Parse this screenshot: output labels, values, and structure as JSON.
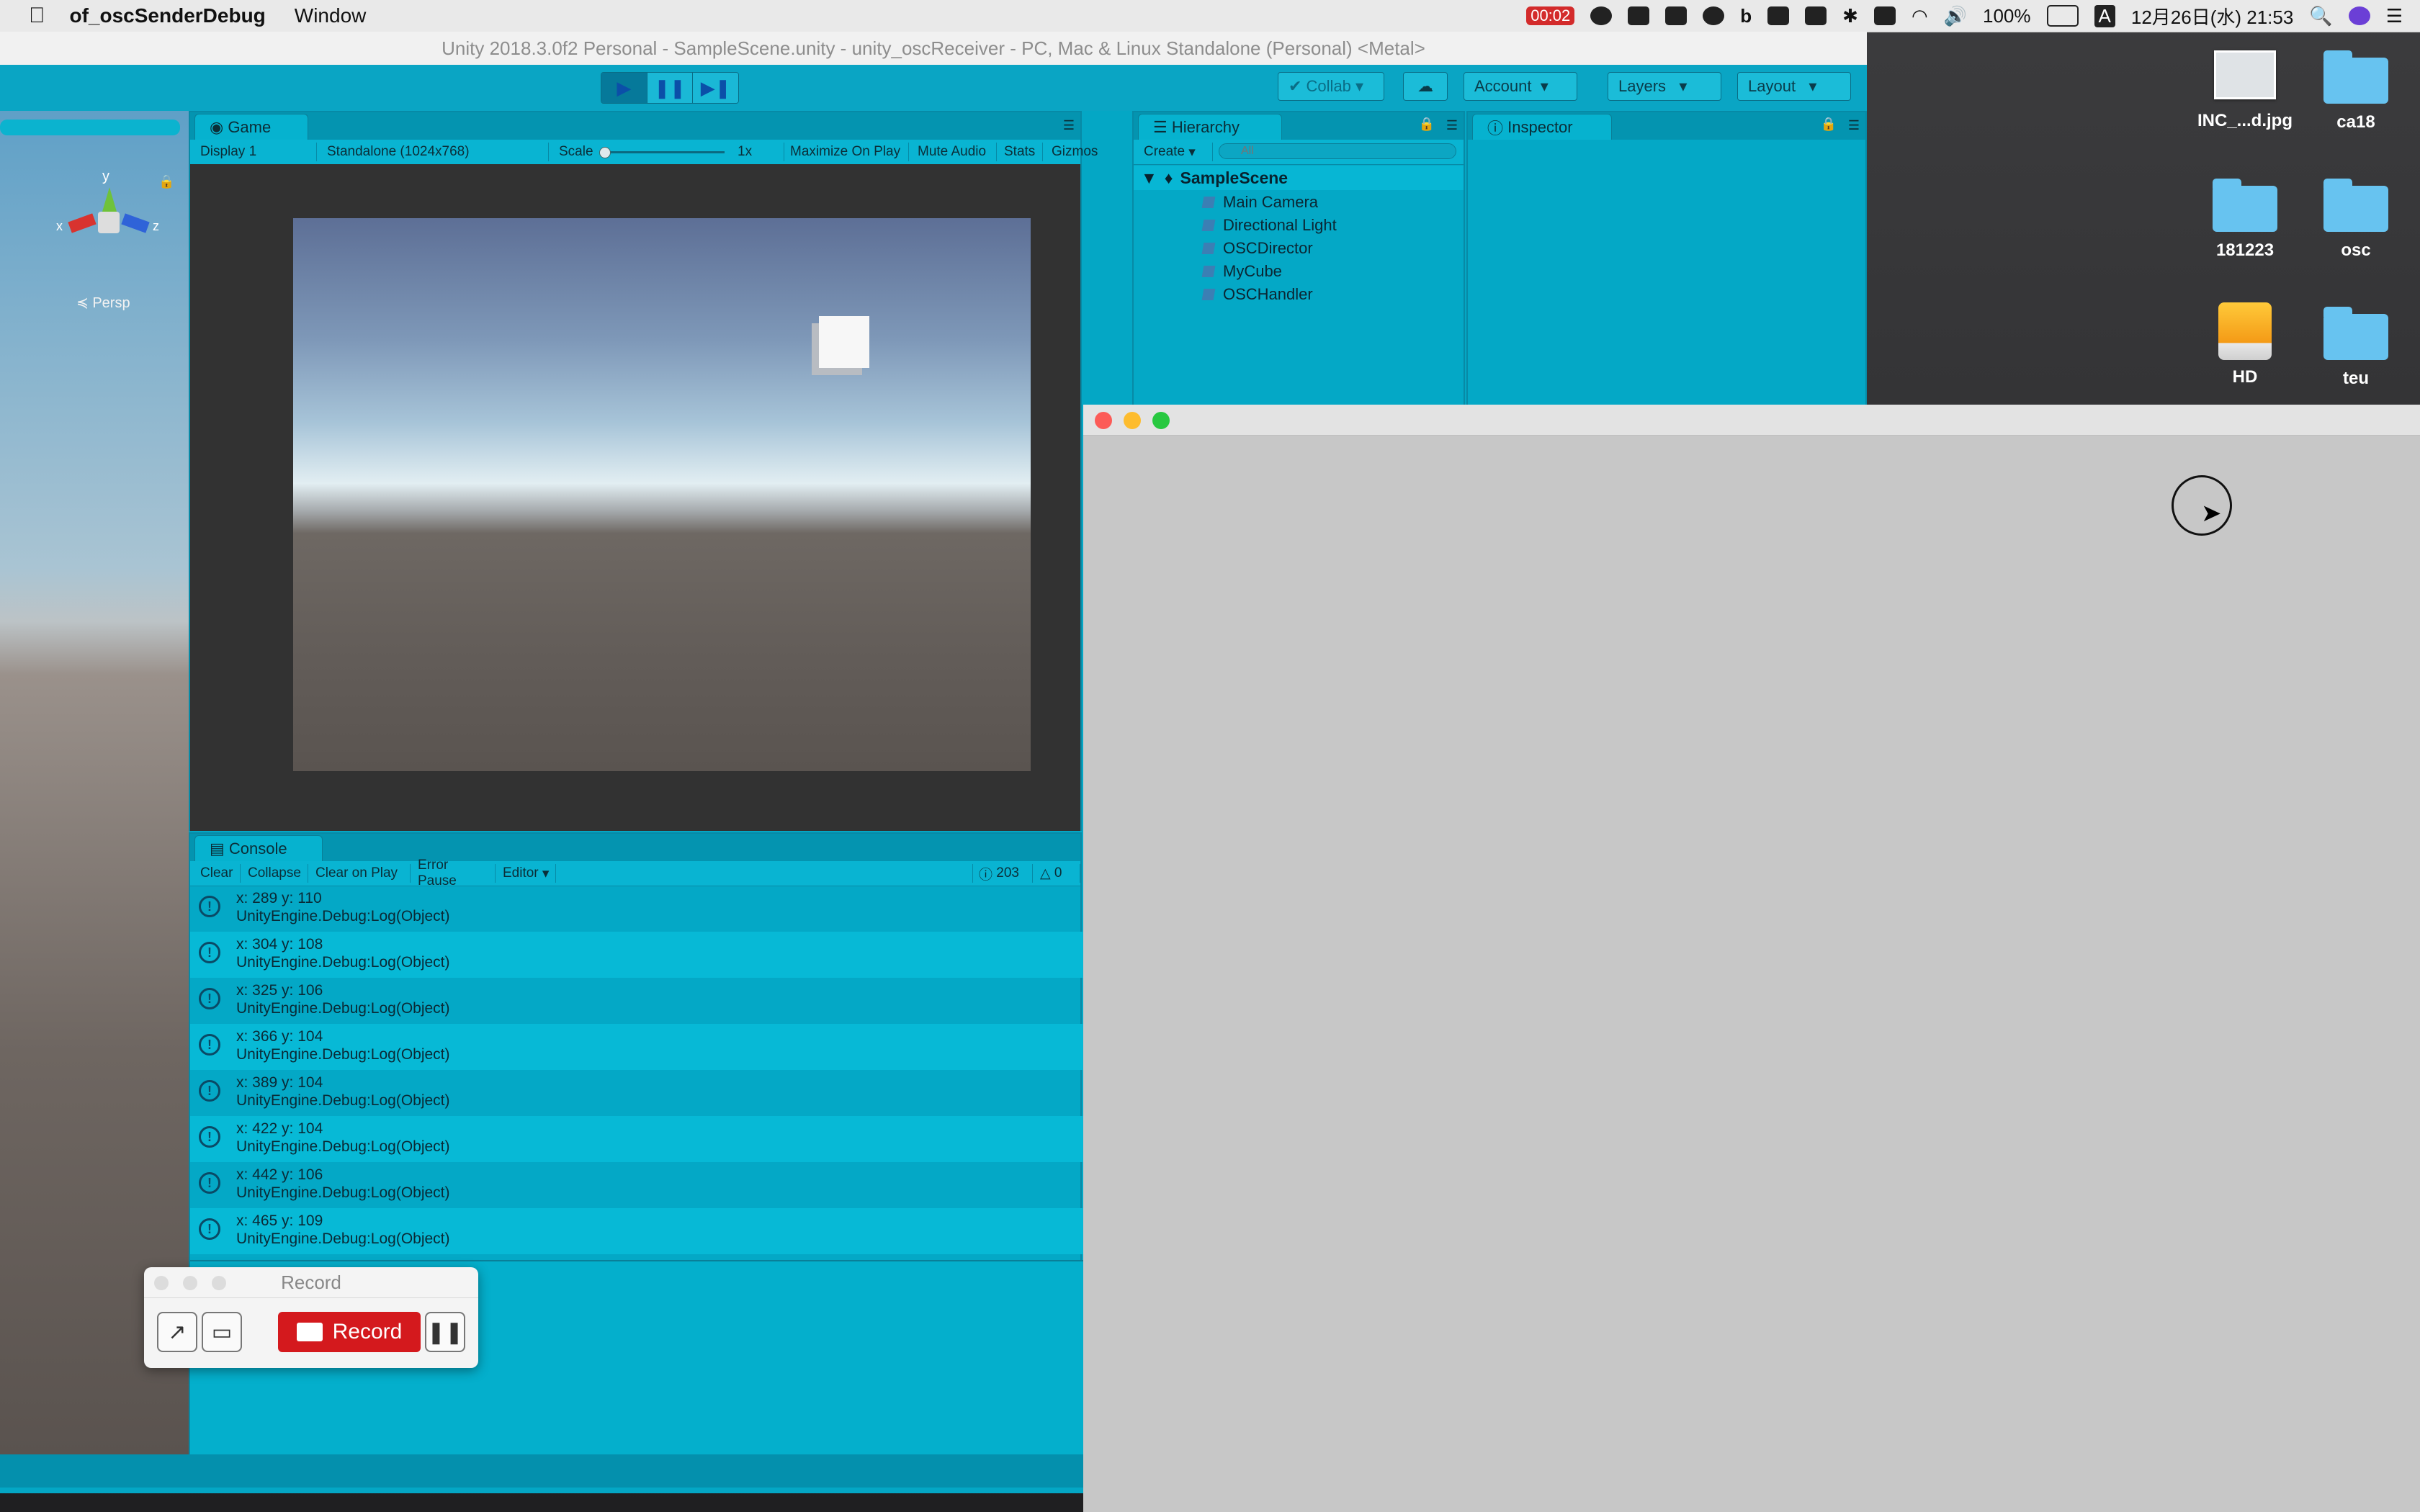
{
  "menubar": {
    "app_name": "of_oscSenderDebug",
    "menu_window": "Window",
    "rec_time": "00:02",
    "battery": "100%",
    "input_method": "A",
    "datetime": "12月26日(水) 21:53"
  },
  "unity": {
    "title": "Unity 2018.3.0f2 Personal - SampleScene.unity - unity_oscReceiver - PC, Mac & Linux Standalone (Personal) <Metal>",
    "toolbar": {
      "collab": "Collab",
      "account": "Account",
      "layers": "Layers",
      "layout": "Layout"
    },
    "scene": {
      "persp_label": "≼ Persp",
      "axis_y": "y",
      "axis_x": "x",
      "axis_z": "z"
    },
    "game": {
      "tab": "Game",
      "display": "Display 1",
      "resolution": "Standalone (1024x768)",
      "scale_label": "Scale",
      "scale_value": "1x",
      "maximize": "Maximize On Play",
      "mute": "Mute Audio",
      "stats": "Stats",
      "gizmos": "Gizmos"
    },
    "hierarchy": {
      "tab": "Hierarchy",
      "create": "Create",
      "search_placeholder": "All",
      "scene_name": "SampleScene",
      "items": [
        {
          "label": "Main Camera"
        },
        {
          "label": "Directional Light"
        },
        {
          "label": "OSCDirector"
        },
        {
          "label": "MyCube"
        },
        {
          "label": "OSCHandler"
        }
      ]
    },
    "inspector": {
      "tab": "Inspector"
    },
    "console": {
      "tab": "Console",
      "clear": "Clear",
      "collapse": "Collapse",
      "clear_on_play": "Clear on Play",
      "error_pause": "Error Pause",
      "editor": "Editor",
      "info_count": "203",
      "warn_count": "0",
      "rows": [
        {
          "msg": "x: 289 y: 110",
          "trace": "UnityEngine.Debug:Log(Object)"
        },
        {
          "msg": "x: 304 y: 108",
          "trace": "UnityEngine.Debug:Log(Object)"
        },
        {
          "msg": "x: 325 y: 106",
          "trace": "UnityEngine.Debug:Log(Object)"
        },
        {
          "msg": "x: 366 y: 104",
          "trace": "UnityEngine.Debug:Log(Object)"
        },
        {
          "msg": "x: 389 y: 104",
          "trace": "UnityEngine.Debug:Log(Object)"
        },
        {
          "msg": "x: 422 y: 104",
          "trace": "UnityEngine.Debug:Log(Object)"
        },
        {
          "msg": "x: 442 y: 106",
          "trace": "UnityEngine.Debug:Log(Object)"
        },
        {
          "msg": "x: 465 y: 109",
          "trace": "UnityEngine.Debug:Log(Object)"
        }
      ]
    }
  },
  "record_widget": {
    "title": "Record",
    "record_label": "Record"
  },
  "desktop_icons": [
    {
      "label": "INC_...d.jpg",
      "icon": "image-file-icon"
    },
    {
      "label": "ca18",
      "icon": "folder-icon"
    },
    {
      "label": "181223",
      "icon": "folder-icon"
    },
    {
      "label": "osc",
      "icon": "folder-icon"
    },
    {
      "label": "HD",
      "icon": "drive-icon"
    },
    {
      "label": "teu",
      "icon": "folder-icon"
    }
  ],
  "colors": {
    "unity_accent": "#04a8c6",
    "record_red": "#d4191d",
    "ofx_window": "#c7c7c7"
  }
}
